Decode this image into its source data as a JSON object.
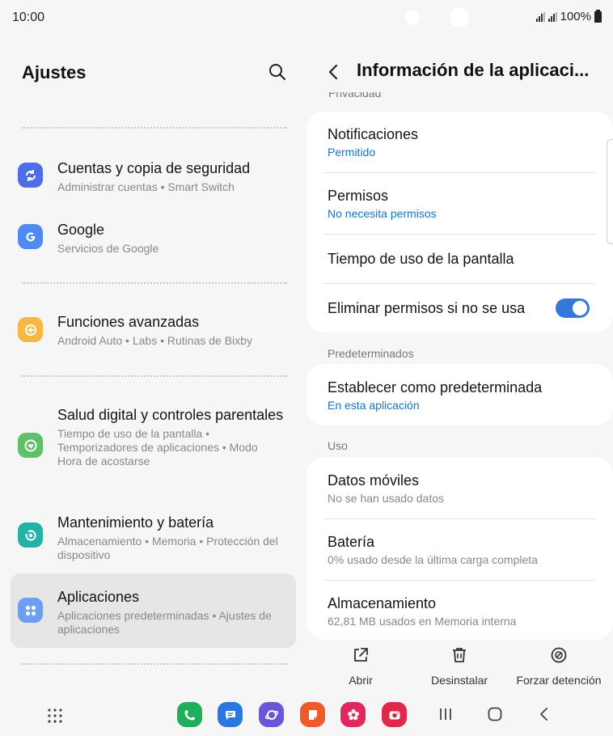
{
  "status_bar": {
    "time": "10:00",
    "battery": "100%"
  },
  "left_pane": {
    "title": "Ajustes",
    "items": [
      {
        "title": "Cuentas y copia de seguridad",
        "subtitle": "Administrar cuentas • Smart Switch",
        "icon": "sync-icon",
        "color": "#4e6ee8"
      },
      {
        "title": "Google",
        "subtitle": "Servicios de Google",
        "icon": "google-icon",
        "color": "#4e8af0"
      },
      {
        "title": "Funciones avanzadas",
        "subtitle": "Android Auto • Labs • Rutinas de Bixby",
        "icon": "plus-icon",
        "color": "#f7b843"
      },
      {
        "title": "Salud digital y controles parentales",
        "subtitle": "Tiempo de uso de la pantalla • Temporizadores de aplicaciones • Modo Hora de acostarse",
        "icon": "heart-ring-icon",
        "color": "#5ec16a"
      },
      {
        "title": "Mantenimiento y batería",
        "subtitle": "Almacenamiento • Memoria • Protección del dispositivo",
        "icon": "care-icon",
        "color": "#23b3a6"
      },
      {
        "title": "Aplicaciones",
        "subtitle": "Aplicaciones predeterminadas • Ajustes de aplicaciones",
        "icon": "apps-dots-icon",
        "color": "#6d9ef0"
      }
    ]
  },
  "right_pane": {
    "title": "Información de la aplicaci...",
    "peek_section": "Privacidad",
    "privacy": {
      "notifications": {
        "title": "Notificaciones",
        "value": "Permitido"
      },
      "permissions": {
        "title": "Permisos",
        "value": "No necesita permisos"
      },
      "screen_time": {
        "title": "Tiempo de uso de la pantalla"
      },
      "remove_permissions": {
        "title": "Eliminar permisos si no se usa",
        "enabled": true
      }
    },
    "defaults_section": "Predeterminados",
    "defaults": {
      "title": "Establecer como predeterminada",
      "value": "En esta aplicación"
    },
    "usage_section": "Uso",
    "usage": {
      "mobile_data": {
        "title": "Datos móviles",
        "value": "No se han usado datos"
      },
      "battery": {
        "title": "Batería",
        "value": "0% usado desde la última carga completa"
      },
      "storage": {
        "title": "Almacenamiento",
        "value": "62,81 MB usados en Memoria interna"
      }
    },
    "actions": {
      "open": "Abrir",
      "uninstall": "Desinstalar",
      "force_stop": "Forzar detención"
    }
  },
  "nav_bar": {
    "apps": [
      {
        "name": "phone-icon",
        "color": "#1fae5b"
      },
      {
        "name": "messages-icon",
        "color": "#2b77e0"
      },
      {
        "name": "internet-icon",
        "color": "#6a56d6"
      },
      {
        "name": "notes-icon",
        "color": "#f05a2a"
      },
      {
        "name": "gallery-icon",
        "color": "#e0285f"
      },
      {
        "name": "camera-icon",
        "color": "#e0284a"
      }
    ]
  }
}
